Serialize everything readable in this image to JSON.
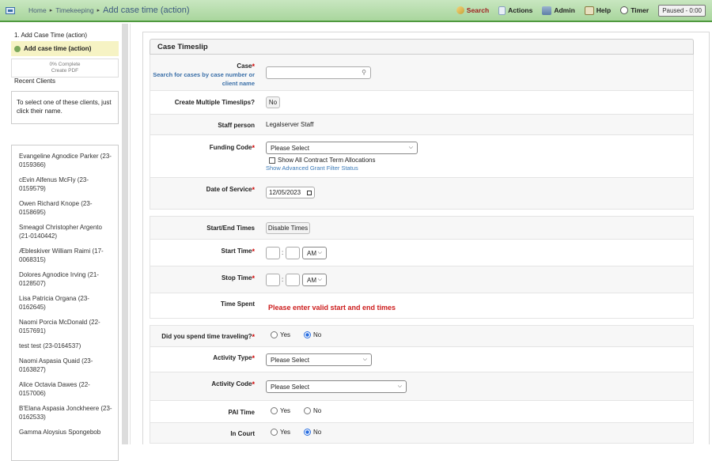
{
  "topbar": {
    "breadcrumb": [
      "Home",
      "Timekeeping",
      "Add case time (action)"
    ],
    "sep": "▸",
    "nav": {
      "search": "Search",
      "actions": "Actions",
      "admin": "Admin",
      "help": "Help",
      "timer": "Timer"
    },
    "paused": "Paused - 0:00"
  },
  "sidebar": {
    "step_title": "1. Add Case Time (action)",
    "step_active": "Add case time (action)",
    "progress": "0% Complete",
    "create_pdf": "Create PDF",
    "recent_label": "Recent Clients",
    "hint": "To select one of these clients, just click their name.",
    "clients": [
      "Evangeline Agnodice Parker (23-0159366)",
      "cEvin Alfenus McFly (23-0159579)",
      "Owen Richard Knope (23-0158695)",
      "Smeagol Christopher Argento (21-0140442)",
      "Æbleskiver William Raimi (17-0068315)",
      "Dolores Agnodice Irving (21-0128507)",
      "Lisa Patricia Organa (23-0162645)",
      "Naomi Porcia McDonald (22-0157691)",
      "test test (23-0164537)",
      "Naomi Aspasia Quaid (23-0163827)",
      "Alice Octavia Dawes (22-0157006)",
      "B'Elana Aspasia Jonckheere (23-0162533)",
      "Gamma Aloysius Spongebob"
    ]
  },
  "form": {
    "title": "Case Timeslip",
    "case_label": "Case",
    "case_sub": "Search for cases by case number or client name",
    "case_value": "",
    "multi_label": "Create Multiple Timeslips?",
    "multi_value": "No",
    "staff_label": "Staff person",
    "staff_value": "Legalserver Staff",
    "funding_label": "Funding Code",
    "funding_value": "Please Select",
    "show_all_label": "Show All Contract Term Allocations",
    "advanced_link": "Show Advanced Grant Filter Status",
    "date_label": "Date of Service",
    "date_value": "12/05/2023",
    "startend_label": "Start/End Times",
    "disable_btn": "Disable Times",
    "start_label": "Start Time",
    "stop_label": "Stop Time",
    "ampm": "AM",
    "colon": ":",
    "spent_label": "Time Spent",
    "spent_error": "Please enter valid start and end times",
    "travel_label": "Did you spend time traveling?",
    "yes": "Yes",
    "no": "No",
    "activity_type_label": "Activity Type",
    "activity_type_value": "Please Select",
    "activity_code_label": "Activity Code",
    "activity_code_value": "Please Select",
    "pai_label": "PAI Time",
    "court_label": "In Court",
    "asterisk": "*"
  },
  "colors": {
    "topbar": "#a9d69d",
    "accent": "#3a6fa8",
    "error": "#cc1b1b",
    "radio_on": "#2a6ee0"
  }
}
